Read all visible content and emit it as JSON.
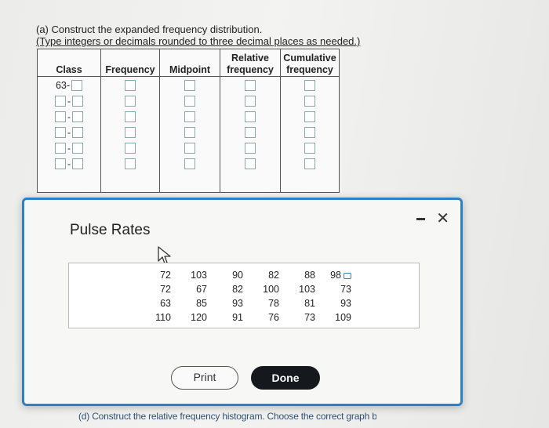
{
  "question": {
    "line1": "(a) Construct the expanded frequency distribution.",
    "line2": "(Type integers or decimals rounded to three decimal places as needed.)"
  },
  "freq_table": {
    "headers": {
      "class": "Class",
      "frequency": "Frequency",
      "midpoint": "Midpoint",
      "relative_top": "Relative",
      "relative_bottom": "frequency",
      "cumulative_top": "Cumulative",
      "cumulative_bottom": "frequency"
    },
    "first_class_lower": "63-",
    "row_count": 6
  },
  "popup": {
    "title": "Pulse Rates",
    "data_rows": [
      [
        "72",
        "103",
        "90",
        "82",
        "88",
        "98"
      ],
      [
        "72",
        "67",
        "82",
        "100",
        "103",
        "73"
      ],
      [
        "63",
        "85",
        "93",
        "78",
        "81",
        "93"
      ],
      [
        "110",
        "120",
        "91",
        "76",
        "73",
        "109"
      ]
    ],
    "print_label": "Print",
    "done_label": "Done"
  },
  "bottom_text": "(d) Construct the relative frequency histogram. Choose the correct graph below.",
  "colors": {
    "accent": "#2f7fc6",
    "done_bg": "#15181c"
  }
}
